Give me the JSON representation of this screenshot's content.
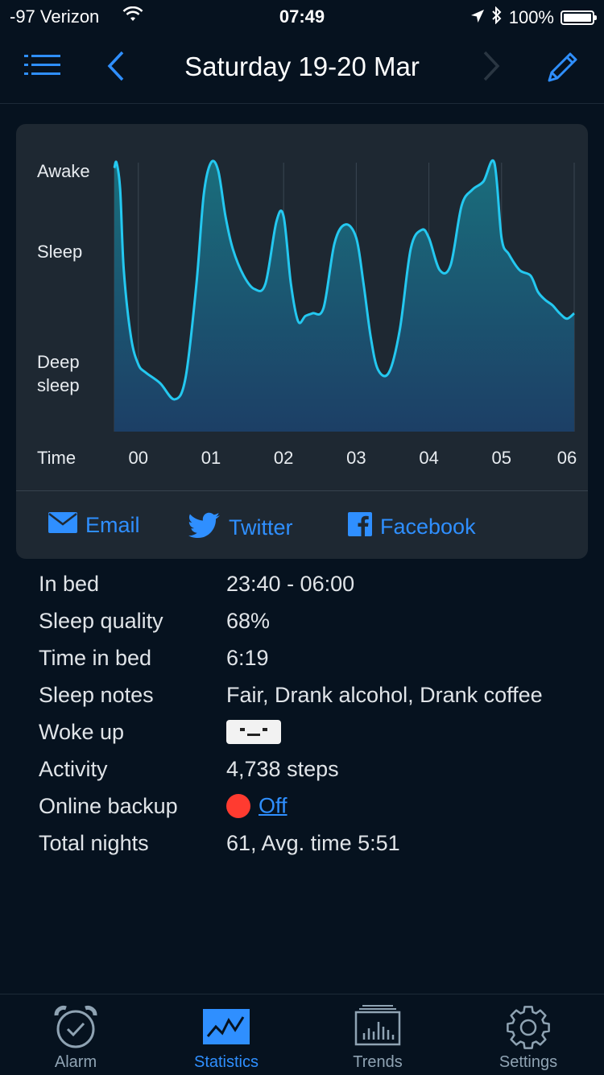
{
  "status_bar": {
    "carrier": "-97 Verizon",
    "time": "07:49",
    "battery": "100%"
  },
  "nav": {
    "title": "Saturday 19-20 Mar"
  },
  "chart_data": {
    "type": "area",
    "y_labels": [
      "Awake",
      "Sleep",
      "Deep",
      "sleep"
    ],
    "xlabel": "Time",
    "x_ticks": [
      "00",
      "01",
      "02",
      "03",
      "04",
      "05",
      "06"
    ],
    "x": [
      23.67,
      23.7,
      23.75,
      23.8,
      23.9,
      24.0,
      24.1,
      24.3,
      24.5,
      24.65,
      24.8,
      24.9,
      25.0,
      25.1,
      25.2,
      25.3,
      25.45,
      25.6,
      25.75,
      25.9,
      26.0,
      26.1,
      26.2,
      26.3,
      26.4,
      26.55,
      26.7,
      26.85,
      27.0,
      27.1,
      27.2,
      27.3,
      27.45,
      27.6,
      27.75,
      27.9,
      28.0,
      28.15,
      28.3,
      28.45,
      28.6,
      28.75,
      28.9,
      29.0,
      29.1,
      29.25,
      29.4,
      29.5,
      29.6,
      29.7,
      29.8,
      29.9,
      30.0
    ],
    "values": [
      0.98,
      1.0,
      0.9,
      0.6,
      0.35,
      0.25,
      0.22,
      0.18,
      0.12,
      0.2,
      0.55,
      0.88,
      1.0,
      0.97,
      0.8,
      0.68,
      0.58,
      0.53,
      0.55,
      0.78,
      0.8,
      0.55,
      0.41,
      0.43,
      0.44,
      0.46,
      0.7,
      0.77,
      0.72,
      0.55,
      0.35,
      0.23,
      0.22,
      0.38,
      0.68,
      0.75,
      0.72,
      0.6,
      0.62,
      0.84,
      0.9,
      0.93,
      1.0,
      0.72,
      0.66,
      0.6,
      0.58,
      0.52,
      0.49,
      0.47,
      0.44,
      0.42,
      0.44
    ],
    "ylim": [
      0,
      1
    ],
    "xlim": [
      23.67,
      30.0
    ],
    "grid": true
  },
  "share": {
    "email": "Email",
    "twitter": "Twitter",
    "facebook": "Facebook"
  },
  "details": {
    "in_bed_label": "In bed",
    "in_bed_value": "23:40 - 06:00",
    "quality_label": "Sleep quality",
    "quality_value": "68%",
    "time_in_bed_label": "Time in bed",
    "time_in_bed_value": "6:19",
    "notes_label": "Sleep notes",
    "notes_value": "Fair, Drank alcohol, Drank coffee",
    "woke_label": "Woke up",
    "activity_label": "Activity",
    "activity_value": "4,738 steps",
    "backup_label": "Online backup",
    "backup_value": "Off",
    "total_label": "Total nights",
    "total_value": "61, Avg. time 5:51"
  },
  "tabs": [
    {
      "label": "Alarm",
      "icon": "alarm-clock-icon"
    },
    {
      "label": "Statistics",
      "icon": "statistics-icon"
    },
    {
      "label": "Trends",
      "icon": "trends-icon"
    },
    {
      "label": "Settings",
      "icon": "gear-icon"
    }
  ],
  "colors": {
    "accent": "#2f8fff",
    "line": "#24c8f0",
    "backup_off": "#ff3b30"
  }
}
